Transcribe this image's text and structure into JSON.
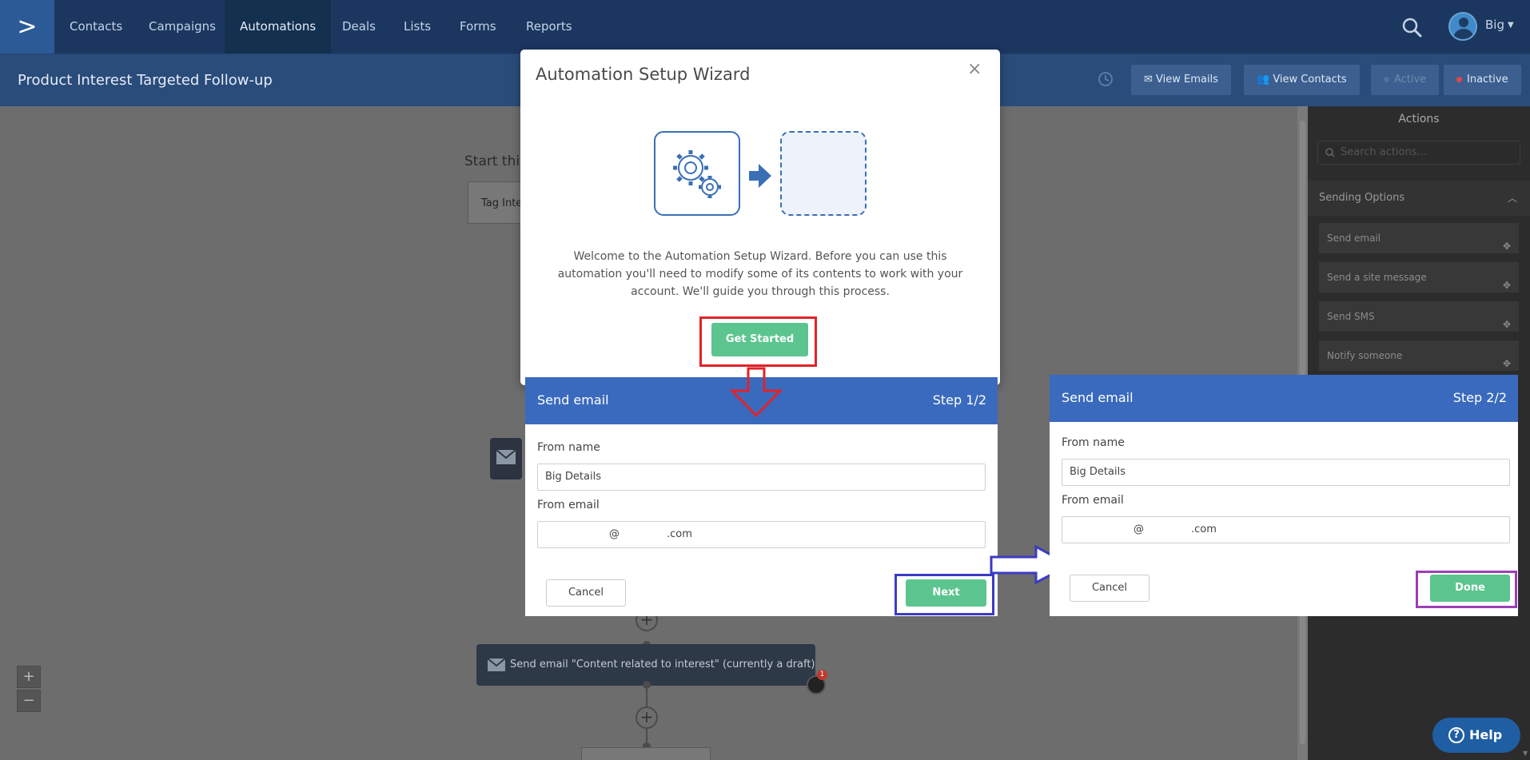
{
  "nav": {
    "logo": ">",
    "items": [
      "Contacts",
      "Campaigns",
      "Automations",
      "Deals",
      "Lists",
      "Forms",
      "Reports"
    ],
    "active": "Automations",
    "user": "Big"
  },
  "header": {
    "title": "Product Interest Targeted Follow-up",
    "view_emails": "View Emails",
    "view_contacts": "View Contacts",
    "active": "Active",
    "inactive": "Inactive"
  },
  "canvas": {
    "start_text": "Start this",
    "trigger": "Tag Inte",
    "node_label": "Send email \"Content related to interest\" (currently a draft)",
    "comment_count": "1",
    "zoom_in": "+",
    "zoom_out": "−",
    "add_step": "+"
  },
  "actions_panel": {
    "title": "Actions",
    "search_placeholder": "Search actions...",
    "section": "Sending Options",
    "items": [
      "Send email",
      "Send a site message",
      "Send SMS",
      "Notify someone"
    ]
  },
  "help": {
    "label": "Help",
    "icon": "?"
  },
  "modal": {
    "title": "Automation Setup Wizard",
    "close": "×",
    "text": "Welcome to the Automation Setup Wizard. Before you can use this automation you'll need to modify some of its contents to work with your account. We'll guide you through this process.",
    "button": "Get Started"
  },
  "step1": {
    "title": "Send email",
    "step": "Step 1/2",
    "from_name_label": "From name",
    "from_name": "Big Details",
    "from_email_label": "From email",
    "email_at": "@",
    "email_tld": ".com",
    "cancel": "Cancel",
    "next": "Next"
  },
  "step2": {
    "title": "Send email",
    "step": "Step 2/2",
    "from_name_label": "From name",
    "from_name": "Big Details",
    "from_email_label": "From email",
    "email_at": "@",
    "email_tld": ".com",
    "cancel": "Cancel",
    "done": "Done"
  },
  "colors": {
    "nav_bg": "#1b3760",
    "accent_blue": "#3a6abe",
    "green": "#5cc58f",
    "annotation_red": "#e0232a",
    "annotation_blue": "#3b3bc4",
    "annotation_purple": "#9b3fb5"
  }
}
